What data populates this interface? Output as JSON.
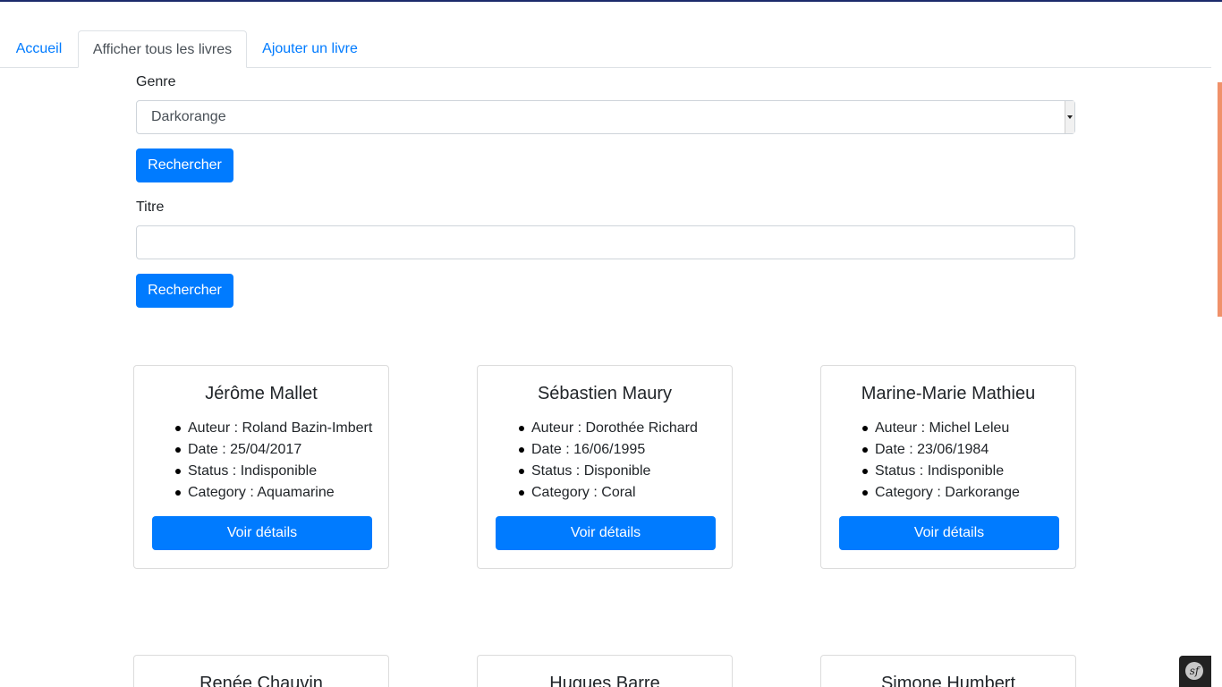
{
  "nav": {
    "tabs": [
      {
        "label": "Accueil"
      },
      {
        "label": "Afficher tous les livres"
      },
      {
        "label": "Ajouter un livre"
      }
    ]
  },
  "search_genre": {
    "label": "Genre",
    "selected_value": "Darkorange",
    "button_label": "Rechercher"
  },
  "search_title": {
    "label": "Titre",
    "value": "",
    "button_label": "Rechercher"
  },
  "books": [
    {
      "title": "Jérôme Mallet",
      "author": "Auteur : Roland Bazin-Imbert",
      "date": "Date : 25/04/2017",
      "status": "Status : Indisponible",
      "category": "Category : Aquamarine",
      "button_label": "Voir détails"
    },
    {
      "title": "Sébastien Maury",
      "author": "Auteur : Dorothée Richard",
      "date": "Date : 16/06/1995",
      "status": "Status : Disponible",
      "category": "Category : Coral",
      "button_label": "Voir détails"
    },
    {
      "title": "Marine-Marie Mathieu",
      "author": "Auteur : Michel Leleu",
      "date": "Date : 23/06/1984",
      "status": "Status : Indisponible",
      "category": "Category : Darkorange",
      "button_label": "Voir détails"
    },
    {
      "title": "Renée Chauvin"
    },
    {
      "title": "Hugues Barre"
    },
    {
      "title": "Simone Humbert"
    }
  ],
  "toolbar": {
    "logo_text": "sf"
  }
}
